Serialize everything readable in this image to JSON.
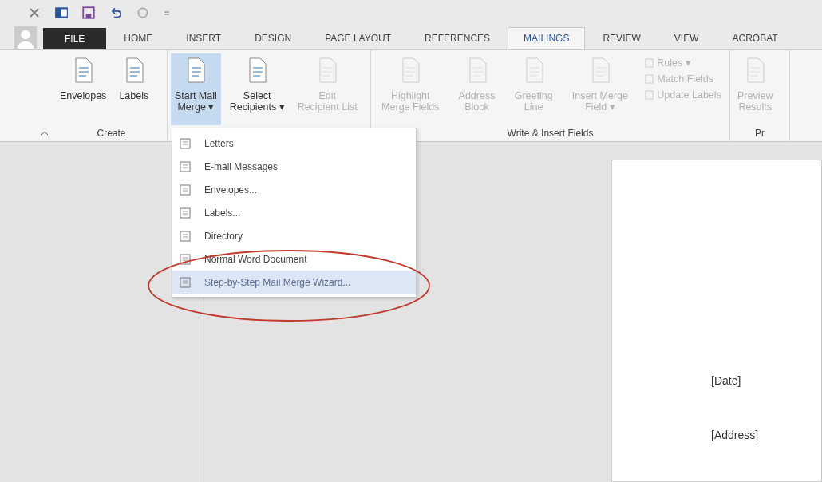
{
  "tabs": [
    {
      "label": "FILE",
      "kind": "file",
      "selected": false
    },
    {
      "label": "HOME",
      "kind": "tab",
      "selected": false
    },
    {
      "label": "INSERT",
      "kind": "tab",
      "selected": false
    },
    {
      "label": "DESIGN",
      "kind": "tab",
      "selected": false
    },
    {
      "label": "PAGE LAYOUT",
      "kind": "tab",
      "selected": false
    },
    {
      "label": "REFERENCES",
      "kind": "tab",
      "selected": false
    },
    {
      "label": "MAILINGS",
      "kind": "tab",
      "selected": true
    },
    {
      "label": "REVIEW",
      "kind": "tab",
      "selected": false
    },
    {
      "label": "VIEW",
      "kind": "tab",
      "selected": false
    },
    {
      "label": "ACROBAT",
      "kind": "tab",
      "selected": false
    }
  ],
  "ribbon_groups": [
    {
      "label": "Create",
      "items": [
        {
          "kind": "large",
          "lines": [
            "Envelopes"
          ],
          "disabled": false,
          "pressed": false
        },
        {
          "kind": "large",
          "lines": [
            "Labels"
          ],
          "disabled": false,
          "pressed": false
        }
      ]
    },
    {
      "items": [
        {
          "kind": "large",
          "lines": [
            "Start Mail",
            "Merge ▾"
          ],
          "disabled": false,
          "pressed": true
        },
        {
          "kind": "large",
          "lines": [
            "Select",
            "Recipients ▾"
          ],
          "disabled": false,
          "pressed": false
        },
        {
          "kind": "large",
          "lines": [
            "Edit",
            "Recipient List"
          ],
          "disabled": true,
          "pressed": false
        }
      ]
    },
    {
      "label": "Write & Insert Fields",
      "items": [
        {
          "kind": "large",
          "lines": [
            "Highlight",
            "Merge Fields"
          ],
          "disabled": true,
          "pressed": false
        },
        {
          "kind": "large",
          "lines": [
            "Address",
            "Block"
          ],
          "disabled": true,
          "pressed": false
        },
        {
          "kind": "large",
          "lines": [
            "Greeting",
            "Line"
          ],
          "disabled": true,
          "pressed": false
        },
        {
          "kind": "large",
          "lines": [
            "Insert Merge",
            "Field ▾"
          ],
          "disabled": true,
          "pressed": false
        },
        {
          "kind": "stack",
          "entries": [
            {
              "label": "Rules ▾",
              "disabled": true
            },
            {
              "label": "Match Fields",
              "disabled": true
            },
            {
              "label": "Update Labels",
              "disabled": true
            }
          ]
        }
      ]
    },
    {
      "label": "Pr",
      "items": [
        {
          "kind": "large",
          "lines": [
            "Preview",
            "Results"
          ],
          "disabled": true,
          "pressed": false
        }
      ]
    }
  ],
  "menu": [
    {
      "label": "Letters",
      "disabled": false,
      "selected": false
    },
    {
      "label": "E-mail Messages",
      "disabled": false,
      "selected": false
    },
    {
      "label": "Envelopes...",
      "disabled": false,
      "selected": false
    },
    {
      "label": "Labels...",
      "disabled": false,
      "selected": false
    },
    {
      "label": "Directory",
      "disabled": false,
      "selected": false
    },
    {
      "label": "Normal Word Document",
      "disabled": false,
      "selected": false
    },
    {
      "label": "Step-by-Step Mail Merge Wizard...",
      "disabled": false,
      "selected": true
    }
  ],
  "document": {
    "lines": [
      "[Date]",
      "[Address]"
    ]
  }
}
